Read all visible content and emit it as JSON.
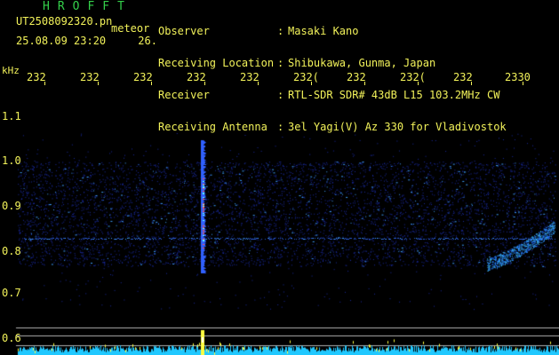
{
  "header": {
    "title": "HROFFT",
    "file_name": "UT2508092320.pn",
    "event_label": "meteor",
    "date_time": "25.08.09 23:20",
    "extra_value": "26.",
    "fields": [
      {
        "label": "Observer",
        "value": "Masaki Kano"
      },
      {
        "label": "Receiving Location",
        "value": "Shibukawa, Gunma, Japan"
      },
      {
        "label": "Receiver",
        "value": "RTL-SDR SDR# 43dB L15 103.2MHz CW"
      },
      {
        "label": "Receiving Antenna",
        "value": "3el Yagi(V) Az 330 for Vladivostok"
      }
    ],
    "separator": ":"
  },
  "axes": {
    "y_unit": "kHz",
    "x_ticks": [
      "232",
      "232",
      "232",
      "232",
      "232",
      "232(",
      "232",
      "232(",
      "232",
      "2330"
    ],
    "y_ticks": [
      "1.1",
      "1.0",
      "0.9",
      "0.8",
      "0.7",
      "0.6"
    ]
  },
  "colors": {
    "text": "#f2f25a",
    "title": "#34d04a",
    "background": "#000000",
    "noise": "#1a2aa0",
    "signal": "#3fa0ff",
    "meteor_core": "#ff5050",
    "power_trace": "#20c8ff",
    "power_peak": "#ffff40"
  }
}
